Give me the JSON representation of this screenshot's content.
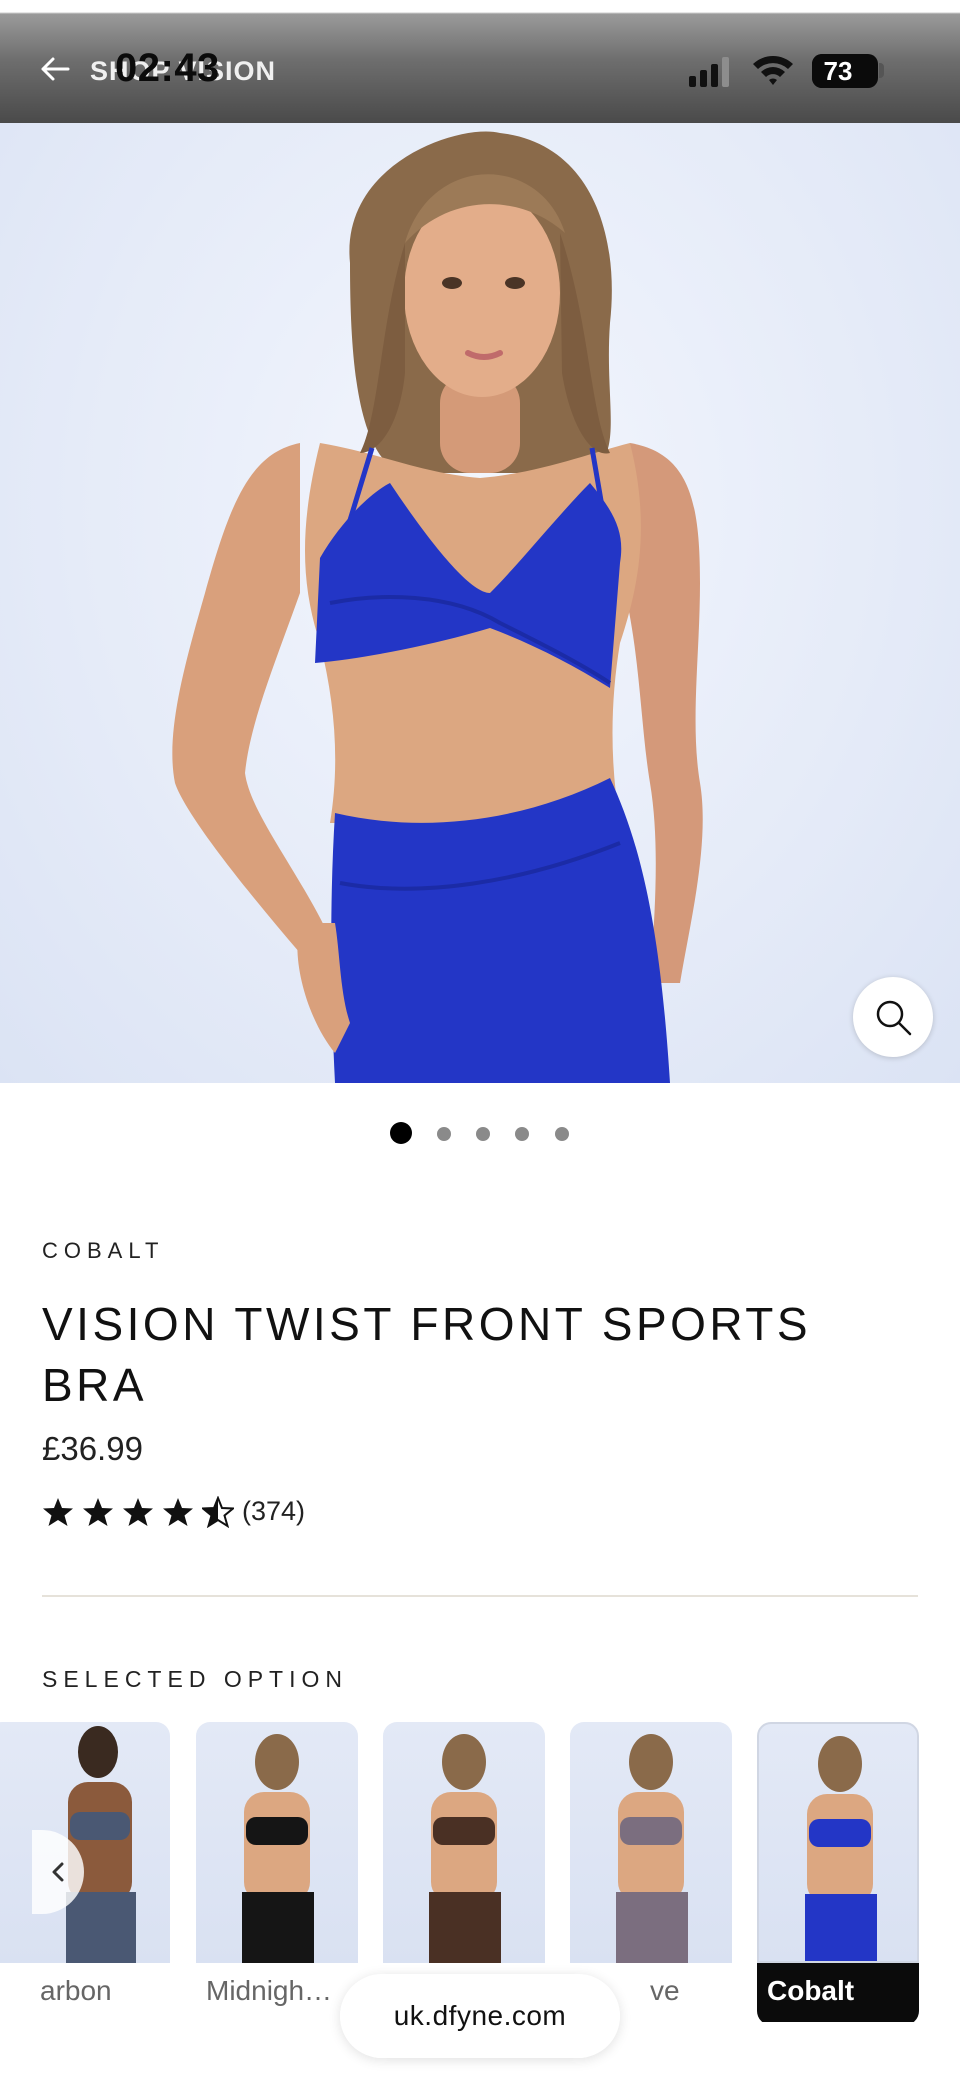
{
  "status_bar": {
    "time": "02:43",
    "battery": "73",
    "battery_fraction": 0.73
  },
  "nav": {
    "title": "SHOP VISION"
  },
  "gallery": {
    "slide_count": 5,
    "active_slide": 1
  },
  "product": {
    "color": "COBALT",
    "title": "VISION TWIST FRONT SPORTS BRA",
    "price": "£36.99",
    "rating_value": 4.5,
    "rating_max": 5,
    "review_count": "(374)"
  },
  "options": {
    "label": "SELECTED OPTION",
    "items": [
      {
        "name": "arbon",
        "garment_color": "#4a5873"
      },
      {
        "name": "Midnigh…",
        "garment_color": "#151515"
      },
      {
        "name": "",
        "garment_color": "#4a3024"
      },
      {
        "name": "ve",
        "garment_color": "#7b6e7f"
      },
      {
        "name": "Cobalt",
        "garment_color": "#2336c6",
        "selected": true
      }
    ]
  },
  "url_bar": {
    "url": "uk.dfyne.com"
  },
  "colors": {
    "cobalt": "#2336c6",
    "text_dark": "#111111",
    "divider": "#e6e2da"
  }
}
